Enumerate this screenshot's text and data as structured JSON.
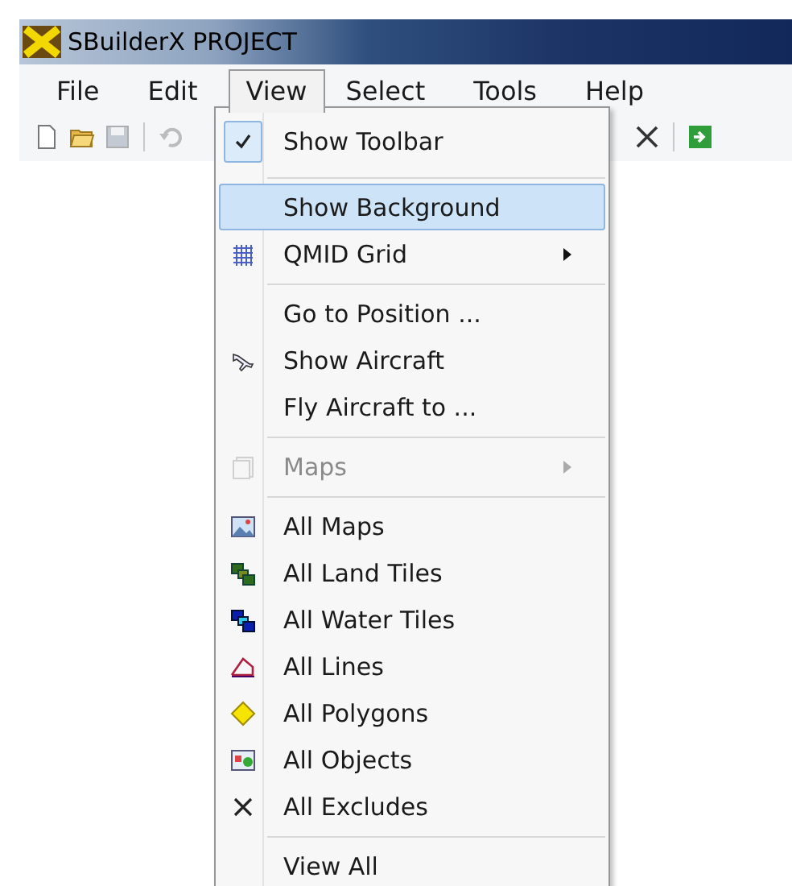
{
  "window": {
    "title": "SBuilderX  PROJECT"
  },
  "menu_bar": [
    {
      "label": "File",
      "selected": false
    },
    {
      "label": "Edit",
      "selected": false
    },
    {
      "label": "View",
      "selected": true
    },
    {
      "label": "Select",
      "selected": false
    },
    {
      "label": "Tools",
      "selected": false
    },
    {
      "label": "Help",
      "selected": false
    }
  ],
  "toolbar_buttons": [
    {
      "disabled": false
    },
    {
      "disabled": false
    },
    {
      "disabled": true
    },
    {
      "disabled": true
    },
    {
      "disabled": false
    },
    {
      "disabled": false
    }
  ],
  "view_menu": [
    {
      "kind": "item",
      "label": "Show Toolbar",
      "checked": true,
      "selected": false,
      "disabled": false,
      "submenu": false
    },
    {
      "kind": "separator"
    },
    {
      "kind": "item",
      "label": "Show Background",
      "checked": false,
      "selected": true,
      "disabled": false,
      "submenu": false
    },
    {
      "kind": "item",
      "label": "QMID Grid",
      "checked": false,
      "selected": false,
      "disabled": false,
      "submenu": true
    },
    {
      "kind": "separator"
    },
    {
      "kind": "item",
      "label": "Go to Position ...",
      "checked": false,
      "selected": false,
      "disabled": false,
      "submenu": false
    },
    {
      "kind": "item",
      "label": "Show Aircraft",
      "checked": false,
      "selected": false,
      "disabled": false,
      "submenu": false
    },
    {
      "kind": "item",
      "label": "Fly Aircraft to ...",
      "checked": false,
      "selected": false,
      "disabled": false,
      "submenu": false
    },
    {
      "kind": "separator"
    },
    {
      "kind": "item",
      "label": "Maps",
      "checked": false,
      "selected": false,
      "disabled": true,
      "submenu": true
    },
    {
      "kind": "separator"
    },
    {
      "kind": "item",
      "label": "All Maps",
      "checked": false,
      "selected": false,
      "disabled": false,
      "submenu": false
    },
    {
      "kind": "item",
      "label": "All Land Tiles",
      "checked": false,
      "selected": false,
      "disabled": false,
      "submenu": false
    },
    {
      "kind": "item",
      "label": "All Water Tiles",
      "checked": false,
      "selected": false,
      "disabled": false,
      "submenu": false
    },
    {
      "kind": "item",
      "label": "All Lines",
      "checked": false,
      "selected": false,
      "disabled": false,
      "submenu": false
    },
    {
      "kind": "item",
      "label": "All Polygons",
      "checked": false,
      "selected": false,
      "disabled": false,
      "submenu": false
    },
    {
      "kind": "item",
      "label": "All Objects",
      "checked": false,
      "selected": false,
      "disabled": false,
      "submenu": false
    },
    {
      "kind": "item",
      "label": "All Excludes",
      "checked": false,
      "selected": false,
      "disabled": false,
      "submenu": false
    },
    {
      "kind": "separator"
    },
    {
      "kind": "item",
      "label": "View All",
      "checked": false,
      "selected": false,
      "disabled": false,
      "submenu": false
    }
  ]
}
